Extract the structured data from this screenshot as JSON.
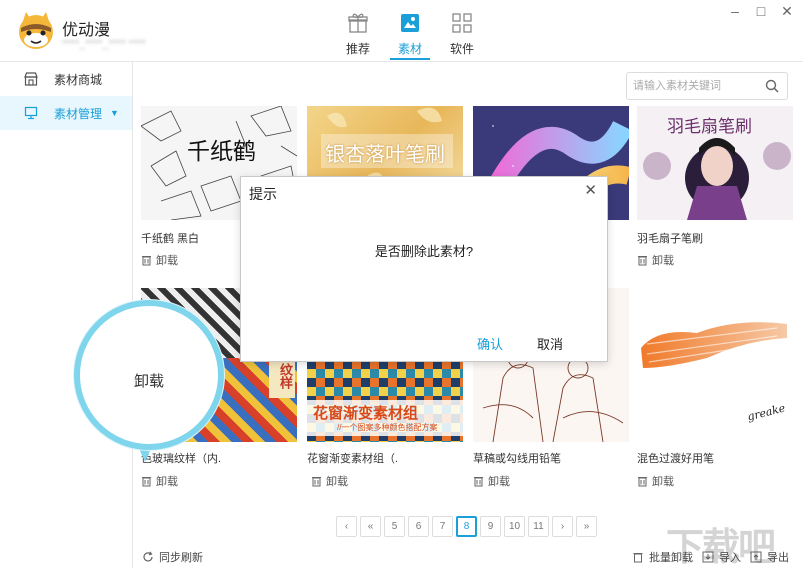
{
  "app": {
    "name": "优动漫",
    "user_info": "****_****_**** ****"
  },
  "topnav": [
    {
      "label": "推荐",
      "icon": "gift-icon",
      "active": false
    },
    {
      "label": "素材",
      "icon": "material-icon",
      "active": true
    },
    {
      "label": "软件",
      "icon": "grid-icon",
      "active": false
    }
  ],
  "window": {
    "minimize": "–",
    "maximize": "□",
    "close": "✕"
  },
  "sidebar": {
    "items": [
      {
        "label": "素材商城",
        "icon": "store-icon"
      },
      {
        "label": "素材管理",
        "icon": "monitor-icon",
        "caret": "▼"
      }
    ]
  },
  "search": {
    "placeholder": "请输入素材关键词"
  },
  "cards": [
    {
      "thumb_text": "千纸鹤",
      "name": "千纸鹤 黑白",
      "uninstall": "卸载"
    },
    {
      "thumb_text": "银杏落叶笔刷",
      "name": "",
      "uninstall": ""
    },
    {
      "thumb_text": "",
      "name": "",
      "uninstall": ""
    },
    {
      "thumb_text": "羽毛扇笔刷",
      "name": "羽毛扇子笔刷",
      "uninstall": "卸载"
    },
    {
      "thumb_text": "纹样",
      "name": "色玻璃纹样（内.",
      "uninstall": "卸载"
    },
    {
      "thumb_text": "花窗渐变素材组",
      "thumb_sub": "//一个图案多种颜色搭配方案",
      "name": "花窗渐变素材组（.",
      "uninstall": "卸载"
    },
    {
      "thumb_text": "",
      "name": "草稿或勾线用铅笔",
      "uninstall": "卸载"
    },
    {
      "thumb_text": "greake",
      "name": "混色过渡好用笔",
      "uninstall": "卸载"
    }
  ],
  "dialog": {
    "title": "提示",
    "close": "✕",
    "message": "是否删除此素材?",
    "ok": "确认",
    "cancel": "取消"
  },
  "callout": {
    "text": "卸载"
  },
  "pagination": [
    "‹",
    "«",
    "5",
    "6",
    "7",
    "8",
    "9",
    "10",
    "11",
    "›",
    "»"
  ],
  "pagination_active": "8",
  "bottombar": {
    "sync": "同步刷新",
    "batch_uninstall": "批量卸载",
    "import": "导入",
    "export": "导出"
  },
  "watermark": "下载吧",
  "colors": {
    "accent": "#1a9fd9",
    "callout_ring": "#7fd6ec"
  }
}
